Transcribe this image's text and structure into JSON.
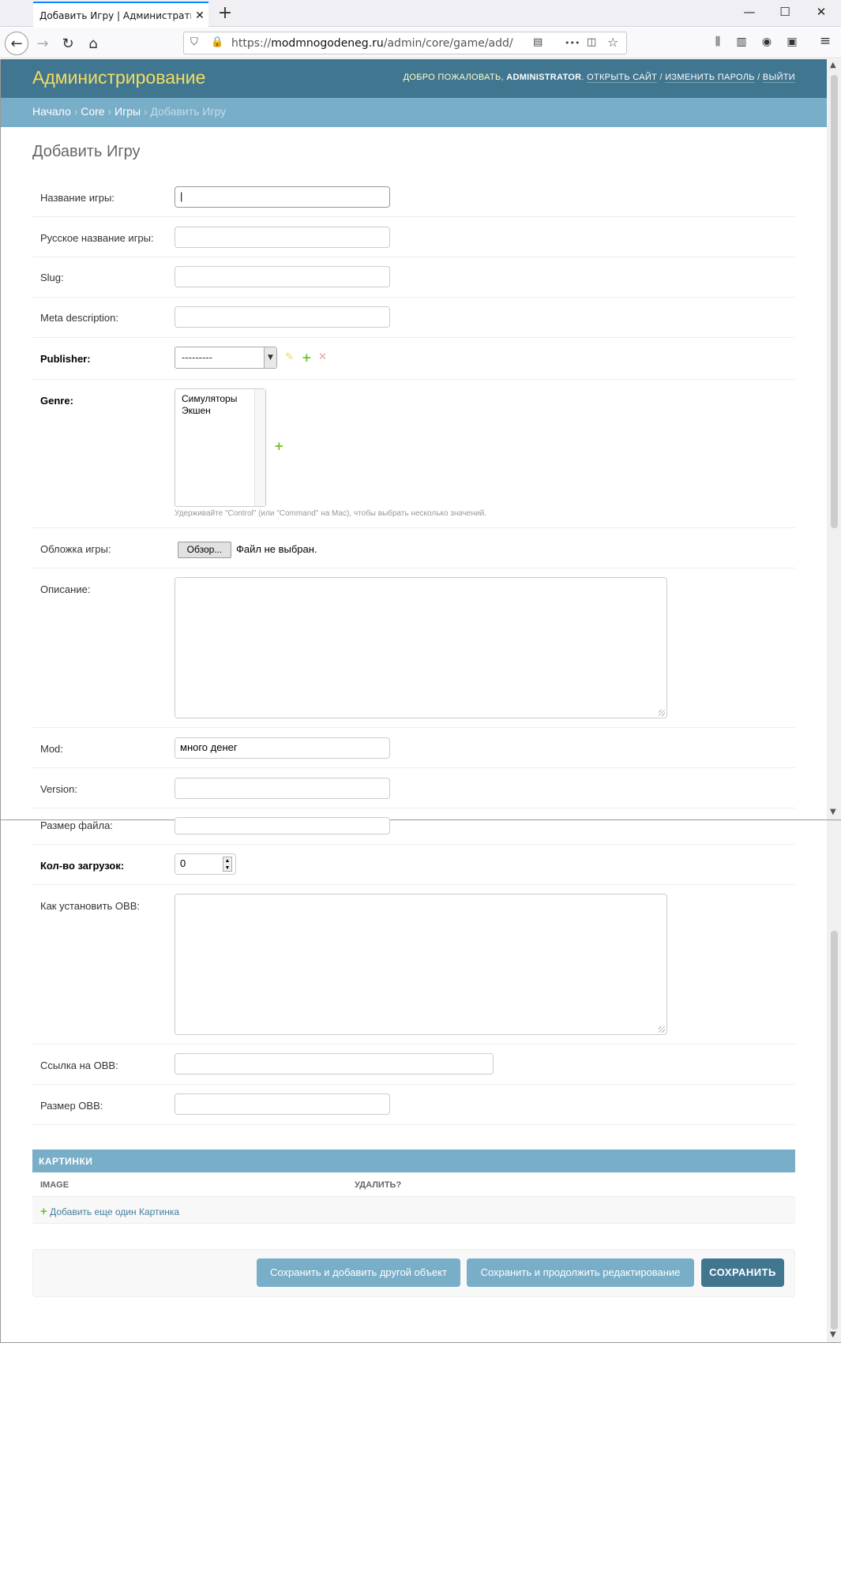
{
  "browser": {
    "tab_title": "Добавить Игру | Административ",
    "new_tab": "+",
    "url_prefix": "https://",
    "url_host": "modmnogodeneg.ru",
    "url_path": "/admin/core/game/add/",
    "more": "•••"
  },
  "admin": {
    "brand": "Администрирование",
    "welcome": "ДОБРО ПОЖАЛОВАТЬ,",
    "username": "ADMINISTRATOR",
    "view_site": "ОТКРЫТЬ САЙТ",
    "change_password": "ИЗМЕНИТЬ ПАРОЛЬ",
    "logout": "ВЫЙТИ",
    "sep": " / "
  },
  "breadcrumbs": {
    "home": "Начало",
    "app": "Core",
    "model": "Игры",
    "current": "Добавить Игру",
    "sep": " › "
  },
  "page_title": "Добавить Игру",
  "form": {
    "name": {
      "label": "Название игры:",
      "value": "|"
    },
    "ru_name": {
      "label": "Русское название игры:",
      "value": ""
    },
    "slug": {
      "label": "Slug:",
      "value": ""
    },
    "meta": {
      "label": "Meta description:",
      "value": ""
    },
    "publisher": {
      "label": "Publisher:",
      "value": "---------"
    },
    "genre": {
      "label": "Genre:",
      "options": [
        "Симуляторы",
        "Экшен"
      ],
      "help": "Удерживайте \"Control\" (или \"Command\" на Mac), чтобы выбрать несколько значений."
    },
    "cover": {
      "label": "Обложка игры:",
      "button": "Обзор...",
      "status": "Файл не выбран."
    },
    "description": {
      "label": "Описание:"
    },
    "mod": {
      "label": "Mod:",
      "value": "много денег"
    },
    "version": {
      "label": "Version:",
      "value": ""
    },
    "file_size": {
      "label": "Размер файла:",
      "value": ""
    },
    "downloads": {
      "label": "Кол-во загрузок:",
      "value": "0"
    },
    "obb_howto": {
      "label": "Как установить OBB:"
    },
    "obb_link": {
      "label": "Ссылка на OBB:",
      "value": ""
    },
    "obb_size": {
      "label": "Размер OBB:",
      "value": ""
    }
  },
  "inline": {
    "title": "КАРТИНКИ",
    "col_image": "IMAGE",
    "col_delete": "УДАЛИТЬ?",
    "add_link": "Добавить еще один Картинка"
  },
  "submit": {
    "save_add": "Сохранить и добавить другой объект",
    "save_continue": "Сохранить и продолжить редактирование",
    "save": "СОХРАНИТЬ"
  },
  "colors": {
    "header": "#417690",
    "breadcrumbs": "#79aec8",
    "brand": "#f5dd5d",
    "add_green": "#70bf2b"
  }
}
